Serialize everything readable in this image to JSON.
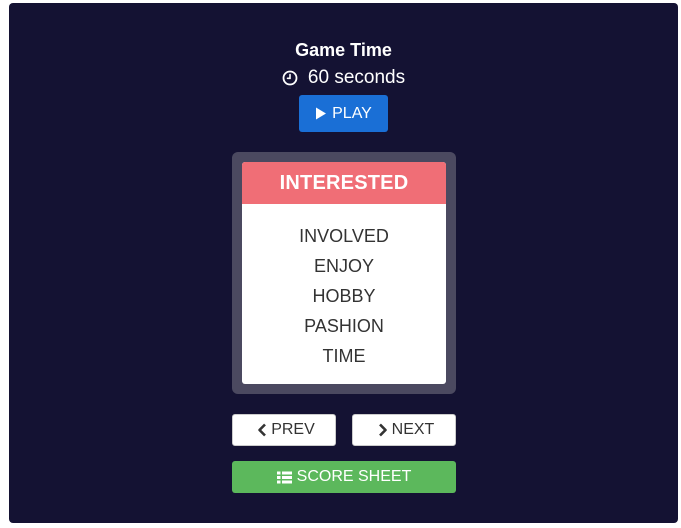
{
  "game": {
    "title": "Game Time",
    "timer_text": "60 seconds"
  },
  "controls": {
    "play_label": "PLAY",
    "prev_label": "PREV",
    "next_label": "NEXT",
    "score_sheet_label": "SCORE SHEET"
  },
  "card": {
    "word": "INTERESTED",
    "taboo_words": [
      "INVOLVED",
      "ENJOY",
      "HOBBY",
      "PASHION",
      "TIME"
    ]
  },
  "colors": {
    "background": "#141233",
    "play_button": "#1a6fd6",
    "card_header": "#f06e76",
    "card_frame": "#4b4960",
    "score_button": "#5cb85c"
  },
  "icons": {
    "timer": "clock-icon",
    "play": "play-icon",
    "prev": "chevron-left-icon",
    "next": "chevron-right-icon",
    "score": "list-icon"
  }
}
